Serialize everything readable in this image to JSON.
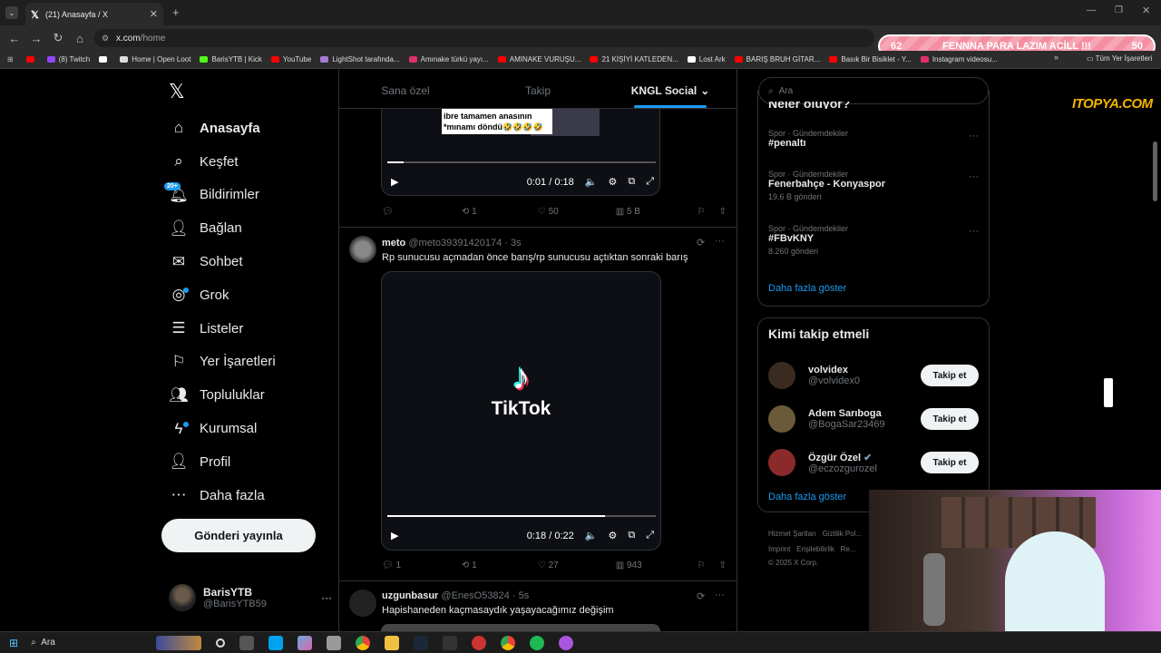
{
  "browser": {
    "tab_title": "(21) Anasayfa / X",
    "url_host": "x.com",
    "url_path": "/home",
    "bookmarks": [
      {
        "label": "",
        "color": "#ff0000"
      },
      {
        "label": "(8) Twitch",
        "color": "#9146ff"
      },
      {
        "label": "",
        "color": "#ffffff"
      },
      {
        "label": "Home | Open Loot",
        "color": "#dddddd"
      },
      {
        "label": "BarisYTB | Kick",
        "color": "#53fc18"
      },
      {
        "label": "YouTube",
        "color": "#ff0000"
      },
      {
        "label": "LightShot tarafında...",
        "color": "#a77bd6"
      },
      {
        "label": "Amınake türkü yayı...",
        "color": "#e1306c"
      },
      {
        "label": "AMINAKE VURUŞU...",
        "color": "#ff0000"
      },
      {
        "label": "21 KİŞİYİ KATLEDEN...",
        "color": "#ff0000"
      },
      {
        "label": "Lost Ark",
        "color": "#ffffff"
      },
      {
        "label": "BARIŞ BRUH GİTAR...",
        "color": "#ff0000"
      },
      {
        "label": "Basık Bir Bisiklet - Y...",
        "color": "#ff0000"
      },
      {
        "label": "Instagram videosu...",
        "color": "#e1306c"
      }
    ],
    "all_bookmarks": "Tüm Yer İşaretleri"
  },
  "overlay": {
    "left_num": "62",
    "text": "FENNNA PARA LAZIM ACİLL !!!",
    "right_num": "50",
    "brand": "ITOPYA.COM"
  },
  "sidebar": {
    "logo": "𝕏",
    "notification_badge": "20+",
    "items": [
      {
        "label": "Anasayfa",
        "icon": "home-icon"
      },
      {
        "label": "Keşfet",
        "icon": "search-icon"
      },
      {
        "label": "Bildirimler",
        "icon": "bell-icon"
      },
      {
        "label": "Bağlan",
        "icon": "add-person-icon"
      },
      {
        "label": "Sohbet",
        "icon": "mail-icon"
      },
      {
        "label": "Grok",
        "icon": "grok-icon"
      },
      {
        "label": "Listeler",
        "icon": "list-icon"
      },
      {
        "label": "Yer İşaretleri",
        "icon": "bookmark-icon"
      },
      {
        "label": "Topluluklar",
        "icon": "communities-icon"
      },
      {
        "label": "Kurumsal",
        "icon": "lightning-icon"
      },
      {
        "label": "Profil",
        "icon": "person-icon"
      },
      {
        "label": "Daha fazla",
        "icon": "more-circle-icon"
      }
    ],
    "post_button": "Gönderi yayınla",
    "profile": {
      "name": "BarisYTB",
      "handle": "@BarisYTB59",
      "more": "···"
    }
  },
  "feed": {
    "tabs": [
      "Sana özel",
      "Takip",
      "KNGL Social"
    ],
    "tweet1": {
      "caption": "ibre tamamen anasının *mınamı döndü🤣🤣🤣🤣",
      "time": "0:01 / 0:18",
      "progress": 0.06,
      "reply": "",
      "retweet": "1",
      "like": "50",
      "views": "5 B"
    },
    "tweet2": {
      "name": "meto",
      "handle": "@meto39391420174",
      "age": "· 3s",
      "text": "Rp sunucusu açmadan önce barış/rp sunucusu açtıktan sonraki barış",
      "video_label": "TikTok",
      "time": "0:18 / 0:22",
      "progress": 0.81,
      "reply": "1",
      "retweet": "1",
      "like": "27",
      "views": "943"
    },
    "tweet3": {
      "name": "uzgunbasur",
      "handle": "@EnesO53824",
      "age": "· 5s",
      "text": "Hapishaneden kaçmasaydık yaşayacağımız değişim"
    }
  },
  "right": {
    "search_placeholder": "Ara",
    "trends_title": "Neler oluyor?",
    "trends": [
      {
        "meta": "Spor · Gündemdekiler",
        "name": "#penaltı",
        "count": ""
      },
      {
        "meta": "Spor · Gündemdekiler",
        "name": "Fenerbahçe - Konyaspor",
        "count": "19,6 B gönderi"
      },
      {
        "meta": "Spor · Gündemdekiler",
        "name": "#FBvKNY",
        "count": "8.260 gönderi"
      }
    ],
    "trends_more": "Daha fazla göster",
    "follow_title": "Kimi takip etmeli",
    "follow": [
      {
        "name": "volvidex",
        "handle": "@volvidex0",
        "button": "Takip et"
      },
      {
        "name": "Adem Sarıboga",
        "handle": "@BogaSar23469",
        "button": "Takip et"
      },
      {
        "name": "Özgür Özel",
        "handle": "@eczozgurozel",
        "button": "Takip et"
      }
    ],
    "follow_more": "Daha fazla göster",
    "footer_line1": [
      "Hizmet Şartları",
      "Gizlilik Pol..."
    ],
    "footer_line2": [
      "Imprint",
      "Erişilebilirlik",
      "Re..."
    ],
    "copyright": "© 2025 X Corp."
  },
  "taskbar": {
    "search": "Ara"
  }
}
